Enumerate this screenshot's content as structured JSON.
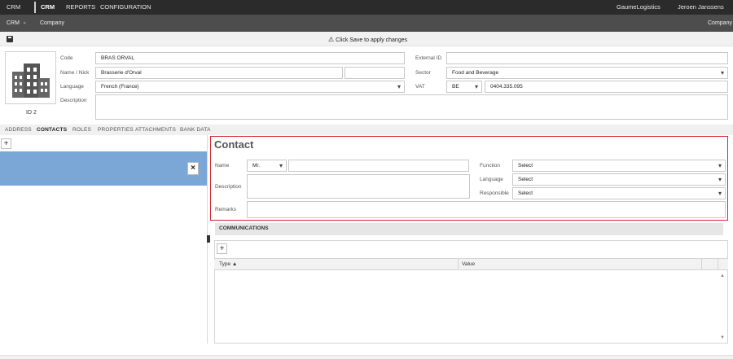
{
  "topnav": {
    "crm": "CRM",
    "crm_active": "CRM",
    "reports": "REPORTS",
    "configuration": "CONFIGURATION",
    "company": "GaumeLogistics",
    "user": "Jeroen Janssens"
  },
  "breadcrumb": {
    "root": "CRM",
    "current": "Company",
    "right": "Company"
  },
  "savebar": {
    "message": "Click Save to apply changes"
  },
  "company": {
    "id_label": "ID 2",
    "code_label": "Code",
    "code_value": "BRAS ORVAL",
    "name_label": "Name / Nick",
    "name_value": "Brasserie d'Orval",
    "nick_value": "",
    "language_label": "Language",
    "language_value": "French (France)",
    "description_label": "Description",
    "external_id_label": "External ID",
    "external_id_value": "",
    "sector_label": "Sector",
    "sector_value": "Food and Beverage",
    "vat_label": "VAT",
    "vat_country": "BE",
    "vat_number": "0404.335.095"
  },
  "tabs": [
    {
      "label": "ADDRESS"
    },
    {
      "label": "CONTACTS"
    },
    {
      "label": "ROLES"
    },
    {
      "label": "PROPERTIES"
    },
    {
      "label": "ATTACHMENTS"
    },
    {
      "label": "BANK DATA"
    }
  ],
  "contact": {
    "title": "Contact",
    "name_label": "Name",
    "salutation": "Mr.",
    "name_value": "",
    "description_label": "Description",
    "remarks_label": "Remarks",
    "function_label": "Function",
    "function_value": "Select",
    "language_label": "Language",
    "language_value": "Select",
    "responsible_label": "Responsible",
    "responsible_value": "Select"
  },
  "communications": {
    "title": "COMMUNICATIONS",
    "col_type": "Type ▲",
    "col_value": "Value"
  },
  "icons": {
    "add": "+",
    "close": "×",
    "warning": "⚠",
    "dropdown": "▾"
  }
}
